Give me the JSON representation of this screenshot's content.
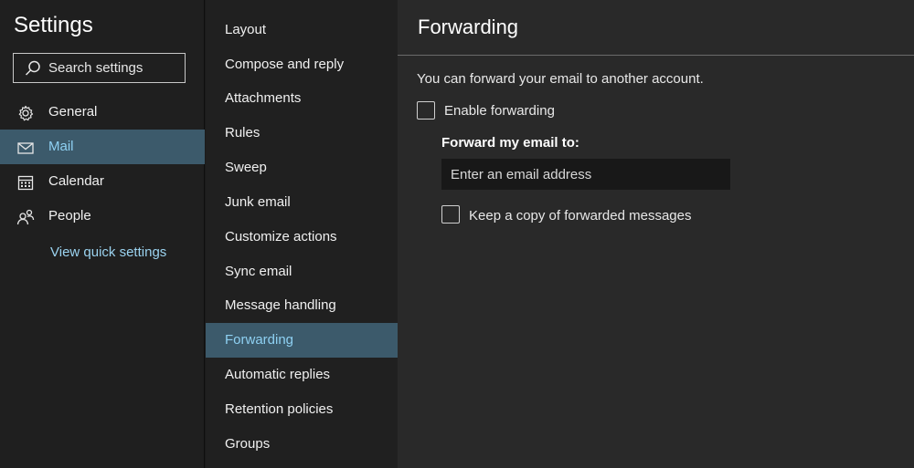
{
  "settings": {
    "title": "Settings",
    "search": {
      "placeholder": "Search settings"
    },
    "nav": [
      {
        "label": "General",
        "icon": "gear-icon",
        "selected": false
      },
      {
        "label": "Mail",
        "icon": "mail-icon",
        "selected": true
      },
      {
        "label": "Calendar",
        "icon": "calendar-icon",
        "selected": false
      },
      {
        "label": "People",
        "icon": "people-icon",
        "selected": false
      }
    ],
    "quick_settings_link": "View quick settings"
  },
  "mail_submenu": [
    {
      "label": "Layout",
      "selected": false
    },
    {
      "label": "Compose and reply",
      "selected": false
    },
    {
      "label": "Attachments",
      "selected": false
    },
    {
      "label": "Rules",
      "selected": false
    },
    {
      "label": "Sweep",
      "selected": false
    },
    {
      "label": "Junk email",
      "selected": false
    },
    {
      "label": "Customize actions",
      "selected": false
    },
    {
      "label": "Sync email",
      "selected": false
    },
    {
      "label": "Message handling",
      "selected": false
    },
    {
      "label": "Forwarding",
      "selected": true
    },
    {
      "label": "Automatic replies",
      "selected": false
    },
    {
      "label": "Retention policies",
      "selected": false
    },
    {
      "label": "Groups",
      "selected": false
    }
  ],
  "forwarding": {
    "title": "Forwarding",
    "description": "You can forward your email to another account.",
    "enable_label": "Enable forwarding",
    "enable_checked": false,
    "forward_to_label": "Forward my email to:",
    "email_placeholder": "Enter an email address",
    "email_value": "",
    "keep_copy_label": "Keep a copy of forwarded messages",
    "keep_copy_checked": false
  },
  "colors": {
    "accent_link": "#9bd3f0",
    "selected_bg": "#3c5a6b",
    "selected_text": "#8ed0f2"
  }
}
